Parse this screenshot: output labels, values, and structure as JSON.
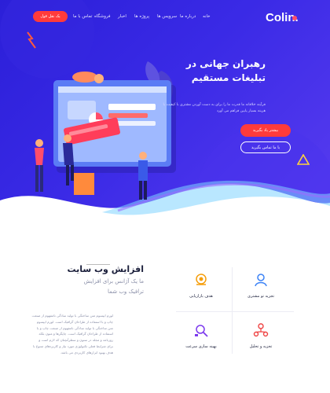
{
  "header": {
    "logo": "Colin.",
    "nav": [
      "خانه",
      "درباره ما",
      "سرویس ها",
      "پروژه ها",
      "اخبار",
      "فروشگاه",
      "تماس با ما"
    ],
    "cta": "یک نقل قول"
  },
  "hero": {
    "title_line1": "رهبران جهانی در",
    "title_line2": "تبلیغات مستقیم",
    "description": "فرآیند خلاقانه ما قدرت ما را برای به دست آوردن مشتری با کیفیت با هزینه بسیار پایین فراهم می آورد",
    "primary_button": "بیشتر یاد بگیرید",
    "secondary_button": "با ما تماس بگیرید"
  },
  "about": {
    "title": "افزایش وب سایت",
    "subtitle_line1": "ما یک آژانس برای افزایش",
    "subtitle_line2": "ترافیک وب شما",
    "text": "لورم ایپسوم متن ساختگی با تولید سادگی نامفهوم از صنعت چاپ و با استفاده از طراحان گرافیک است. لورم ایپسوم متن ساختگی با تولید سادگی نامفهوم از صنعت چاپ و با استفاده از طراحان گرافیک است. چاپگرها و متون بلکه روزنامه و مجله در ستون و سطرآنچنان که لازم است و برای شرایط فعلی تکنولوژی مورد نیاز و کاربردهای متنوع با هدف بهبود ابزارهای کاربردی می باشد."
  },
  "features": [
    {
      "label": "هدف بازاریابی",
      "icon": "target-hand-icon"
    },
    {
      "label": "تجزیه تو مشتری",
      "icon": "customer-analysis-icon"
    },
    {
      "label": "بهینه سازی سرعت",
      "icon": "speed-optimization-icon"
    },
    {
      "label": "تجزیه و تحلیل",
      "icon": "analysis-icon"
    }
  ],
  "colors": {
    "hero_bg": "#2b1fd8",
    "accent": "#ff3b3b",
    "feature_blue": "#3b82f6",
    "feature_orange": "#f59e0b",
    "feature_purple": "#7c3aed",
    "feature_red": "#ef4444"
  }
}
